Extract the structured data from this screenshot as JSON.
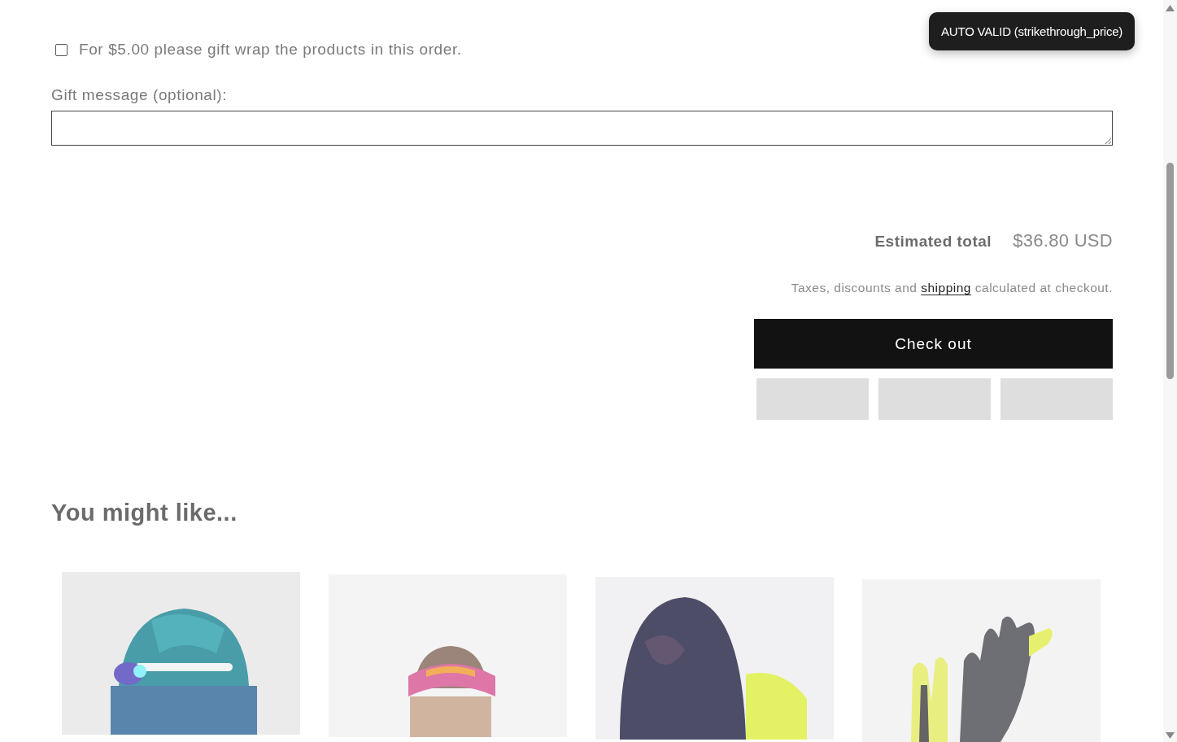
{
  "gift_wrap": {
    "label": "For $5.00 please gift wrap the products in this order.",
    "checked": false
  },
  "gift_message": {
    "label": "Gift message (optional):"
  },
  "summary": {
    "total_label": "Estimated total",
    "total_value": "$36.80 USD",
    "note_before": "Taxes, discounts and ",
    "note_link": "shipping",
    "note_after": " calculated at checkout.",
    "checkout_button": "Check out"
  },
  "payment_buttons": [
    {
      "kind": "placeholder"
    },
    {
      "kind": "placeholder"
    },
    {
      "kind": "placeholder"
    }
  ],
  "recommendations": {
    "title": "You might like..."
  },
  "toast": {
    "text": "AUTO VALID (strikethrough_price)"
  }
}
